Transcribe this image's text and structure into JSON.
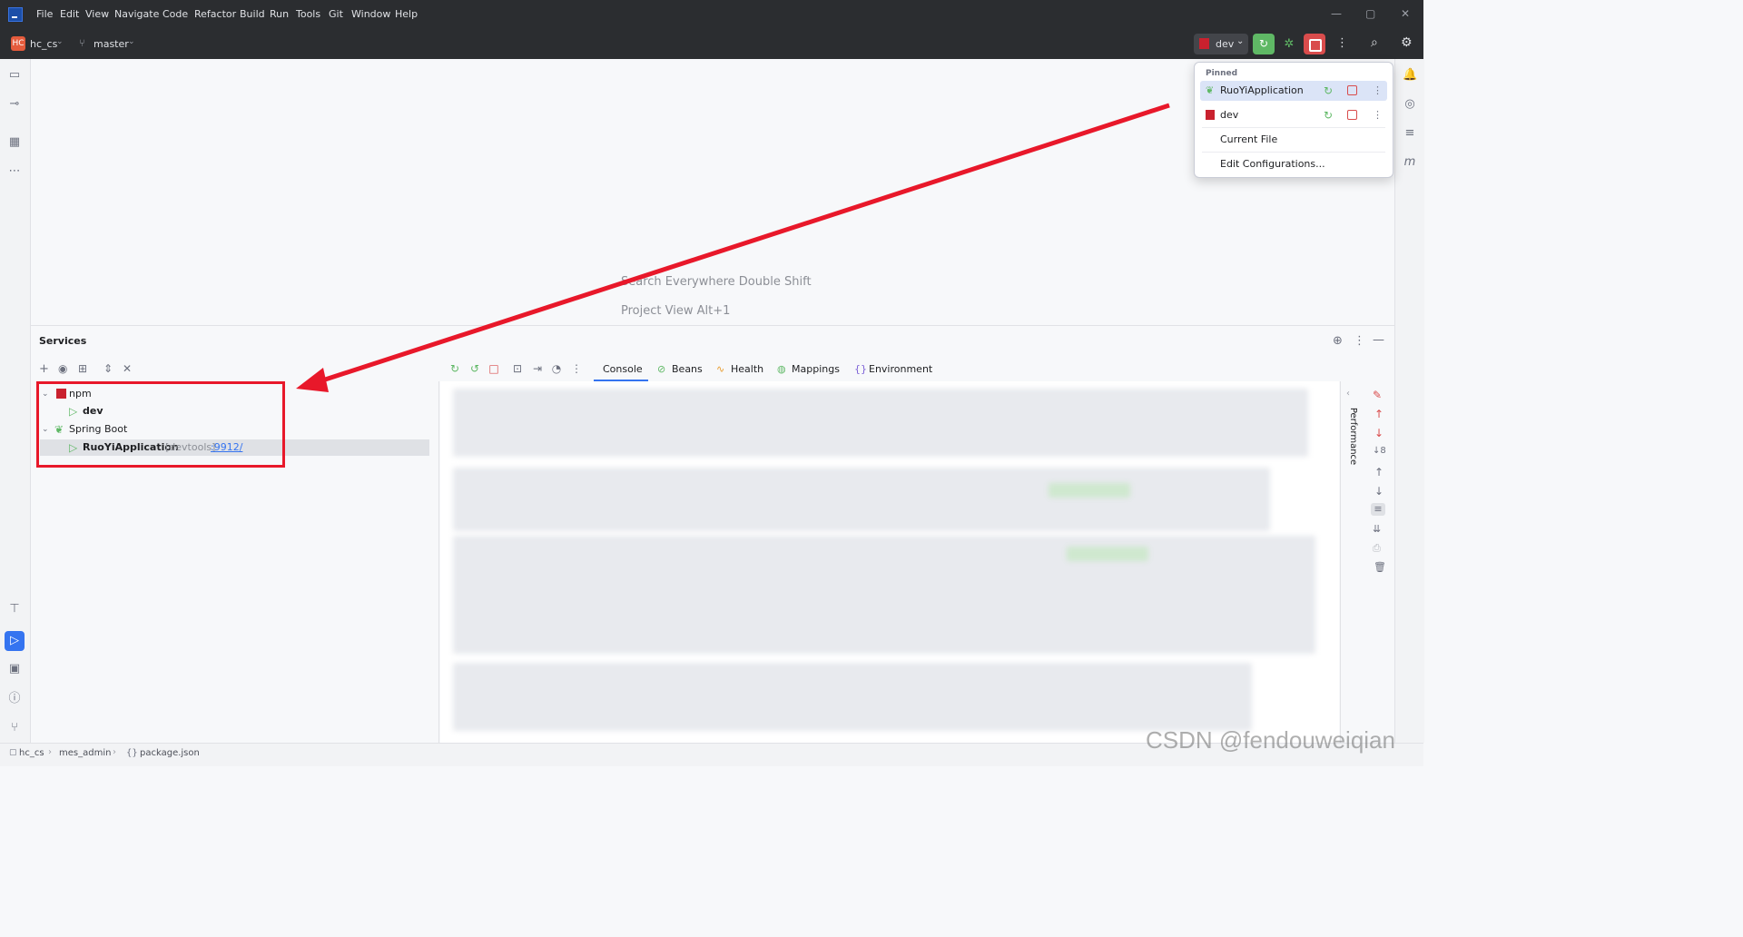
{
  "menu": [
    "File",
    "Edit",
    "View",
    "Navigate",
    "Code",
    "Refactor",
    "Build",
    "Run",
    "Tools",
    "Git",
    "Window",
    "Help"
  ],
  "project": {
    "badge": "HC",
    "name": "hc_cs",
    "branch": "master"
  },
  "run_config": {
    "label": "dev"
  },
  "editor_hints": {
    "search": "Search Everywhere Double Shift",
    "project_view": "Project View Alt+1"
  },
  "services": {
    "title": "Services",
    "tree": {
      "npm_group": "npm",
      "npm_child": "dev",
      "spring_group": "Spring Boot",
      "spring_child": "RuoYiApplication",
      "spring_child_meta": "[devtools]",
      "spring_child_port": ":9912/"
    },
    "tabs": [
      "Console",
      "Beans",
      "Health",
      "Mappings",
      "Environment"
    ],
    "side_label": "Performance"
  },
  "popup": {
    "pinned_label": "Pinned",
    "items": [
      "RuoYiApplication",
      "dev",
      "Current File",
      "Edit Configurations..."
    ]
  },
  "statusbar": {
    "crumbs": [
      "hc_cs",
      "mes_admin",
      "package.json"
    ]
  },
  "watermark": "CSDN @fendouweiqian",
  "colors": {
    "accent_red": "#e8182a",
    "run_green": "#5fb865",
    "selection": "#dbe4f7"
  }
}
